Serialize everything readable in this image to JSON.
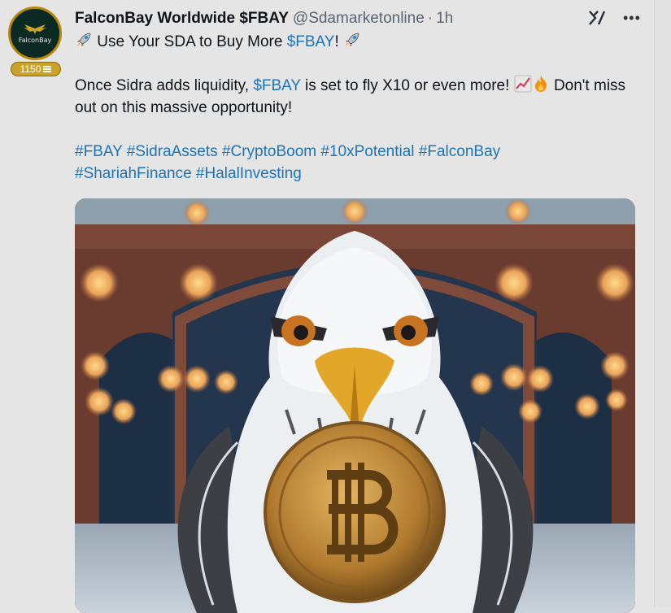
{
  "tweet": {
    "display_name": "FalconBay Worldwide $FBAY",
    "handle": "@Sdamarketonline",
    "separator": "·",
    "time": "1h",
    "avatar_text": "FalconBay",
    "badge_count": "1150",
    "line1_pre": "Use Your SDA to Buy More ",
    "line1_cashtag": "$FBAY",
    "line1_post": "!",
    "para2_pre": "Once Sidra adds liquidity, ",
    "para2_cashtag": "$FBAY",
    "para2_mid": " is set to fly X10 or even more! ",
    "para2_post": " Don't miss out on this massive opportunity!",
    "hashtags_line1": "#FBAY #SidraAssets #CryptoBoom #10xPotential #FalconBay",
    "hashtags_line2": "#ShariahFinance #HalalInvesting"
  },
  "icons": {
    "rocket": "rocket-emoji",
    "chart": "chart-increasing-emoji",
    "fire": "fire-emoji",
    "grok": "grok-icon",
    "more": "more-icon",
    "badge": "coin-icon"
  },
  "colors": {
    "link": "#1d74b4",
    "badge": "#c9a227",
    "background": "#e5e5e5"
  }
}
